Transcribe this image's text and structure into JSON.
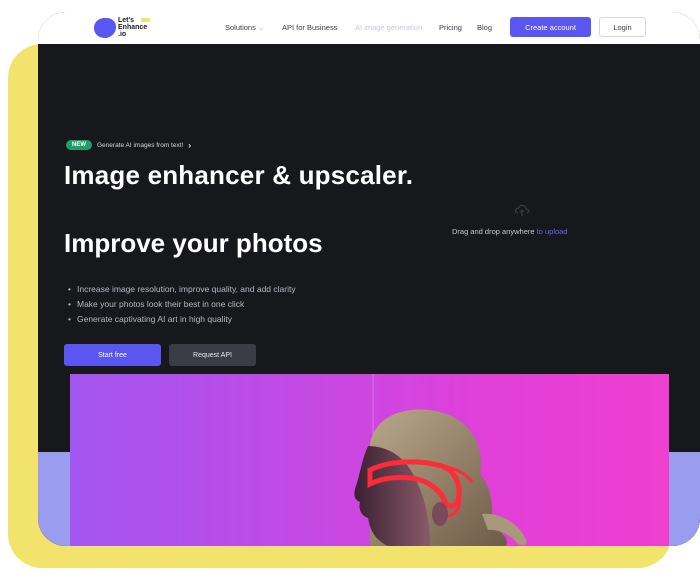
{
  "navbar": {
    "logo_text": "Let's\nEnhance\n.io",
    "items": [
      {
        "label": "Solutions",
        "has_dropdown": true
      },
      {
        "label": "API for Business"
      },
      {
        "label": "AI image generation"
      },
      {
        "label": "Pricing"
      },
      {
        "label": "Blog"
      }
    ],
    "create_account_label": "Create account",
    "login_label": "Login"
  },
  "hero": {
    "badge_new": "NEW",
    "badge_text": "Generate AI images from text!",
    "title_line1": "Image enhancer & upscaler.",
    "title_line2": "Improve your photos",
    "bullets": [
      "Increase image resolution, improve quality, and add clarity",
      "Make your photos look their best in one click",
      "Generate captivating AI art in high quality"
    ],
    "start_free_label": "Start free",
    "request_api_label": "Request API"
  },
  "upload": {
    "text": "Drag and drop anywhere",
    "link": "to upload",
    "icon": "upload-cloud-icon"
  },
  "colors": {
    "accent": "#5b56f0",
    "dark_bg": "#17181c",
    "frame_yellow": "#f2e36c",
    "badge_green": "#1f9e6a",
    "band_lavender": "#9a9cf0",
    "photo_magenta": "#ee3fd0"
  }
}
